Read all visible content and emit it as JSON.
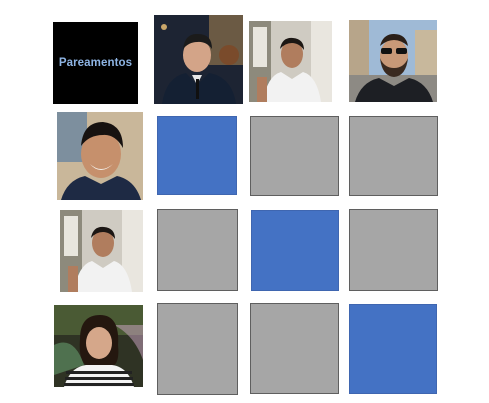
{
  "title_tile": {
    "label": "Pareamentos",
    "text_color": "#8eb4e3",
    "bg": "#000000"
  },
  "colors": {
    "matched": "#4472c4",
    "unmatched": "#a6a6a6"
  },
  "top_photos": [
    {
      "icon": "man-in-suit-portrait"
    },
    {
      "icon": "young-man-white-shirt-selfie"
    },
    {
      "icon": "man-with-sunglasses-beard"
    }
  ],
  "left_photos": [
    {
      "icon": "smiling-man-closeup"
    },
    {
      "icon": "young-man-white-shirt-selfie"
    },
    {
      "icon": "woman-striped-shirt"
    }
  ],
  "grid": [
    [
      "matched",
      "unmatched",
      "unmatched"
    ],
    [
      "unmatched",
      "matched",
      "unmatched"
    ],
    [
      "unmatched",
      "unmatched",
      "matched"
    ]
  ]
}
